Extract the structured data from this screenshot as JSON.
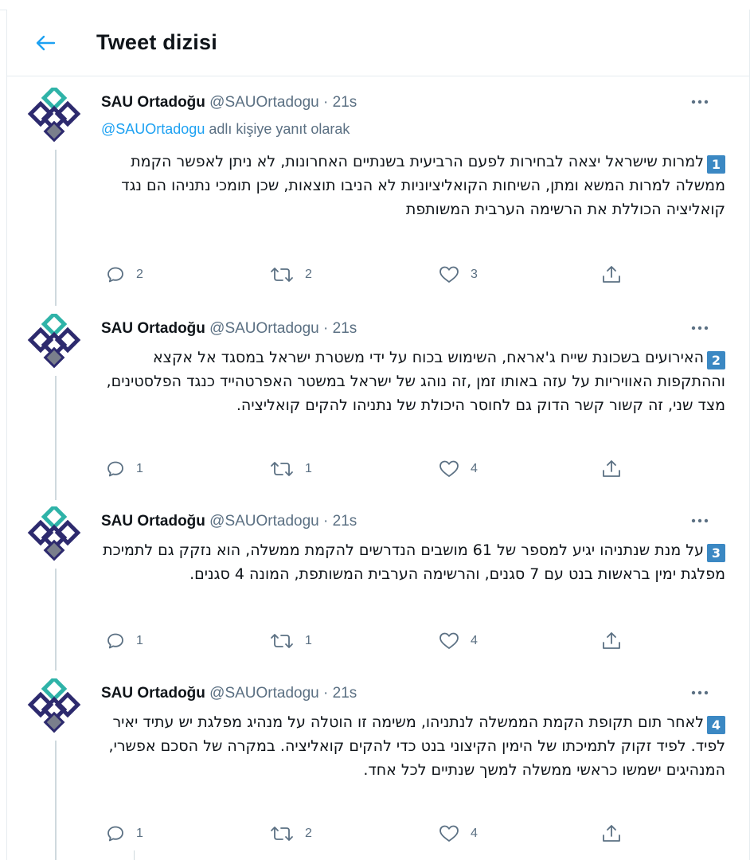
{
  "header": {
    "title": "Tweet dizisi"
  },
  "tweets": [
    {
      "name": "SAU Ortadoğu",
      "handle": "@SAUOrtadogu",
      "separator": "·",
      "time": "21s",
      "reply_prefix": "@SAUOrtadogu",
      "reply_suffix": " adlı kişiye yanıt olarak",
      "number": "1",
      "text": "למרות שישראל יצאה לבחירות לפעם הרביעית בשנתיים האחרונות, לא ניתן לאפשר הקמת ממשלה למרות המשא ומתן, השיחות הקואליציוניות לא הניבו תוצאות, שכן תומכי נתניהו הם נגד קואליציה הכוללת את הרשימה הערבית המשותפת",
      "replies": "2",
      "retweets": "2",
      "likes": "3"
    },
    {
      "name": "SAU Ortadoğu",
      "handle": "@SAUOrtadogu",
      "separator": "·",
      "time": "21s",
      "number": "2",
      "text": "האירועים בשכונת שייח ג'אראח, השימוש בכוח על ידי משטרת ישראל במסגד אל אקצא וההתקפות האוויריות על עזה באותו זמן ,זה נוהג של ישראל במשטר האפרטהייד כנגד הפלסטינים, מצד שני, זה קשור קשר הדוק גם לחוסר היכולת של נתניהו להקים קואליציה.",
      "replies": "1",
      "retweets": "1",
      "likes": "4"
    },
    {
      "name": "SAU Ortadoğu",
      "handle": "@SAUOrtadogu",
      "separator": "·",
      "time": "21s",
      "number": "3",
      "text": "על מנת שנתניהו יגיע למספר של 61 מושבים הנדרשים להקמת ממשלה, הוא נזקק גם לתמיכת מפלגת ימין בראשות בנט עם 7 סגנים, והרשימה הערבית המשותפת, המונה 4 סגנים.",
      "replies": "1",
      "retweets": "1",
      "likes": "4"
    },
    {
      "name": "SAU Ortadoğu",
      "handle": "@SAUOrtadogu",
      "separator": "·",
      "time": "21s",
      "number": "4",
      "text": "לאחר תום תקופת הקמת הממשלה לנתניהו, משימה זו הוטלה על מנהיג מפלגת יש עתיד יאיר לפיד. לפיד זקוק לתמיכתו של הימין הקיצוני בנט כדי להקים קואליציה. במקרה של הסכם אפשרי, המנהיגים ישמשו כראשי ממשלה למשך שנתיים לכל אחד.",
      "replies": "1",
      "retweets": "2",
      "likes": "4"
    }
  ],
  "icons": {
    "back": "arrow-left-icon",
    "more": "more-horizontal-icon",
    "reply": "speech-bubble-icon",
    "retweet": "retweet-arrows-icon",
    "like": "heart-icon",
    "share": "share-upload-icon"
  },
  "colors": {
    "accent": "#1da1f2",
    "text": "#0f1419",
    "muted": "#5b7083",
    "divider": "#e6ecf0",
    "badge": "#3b88c3",
    "logo_teal": "#2fb3a8",
    "logo_navy": "#2d2a6e",
    "logo_grey": "#7a7f8c"
  }
}
